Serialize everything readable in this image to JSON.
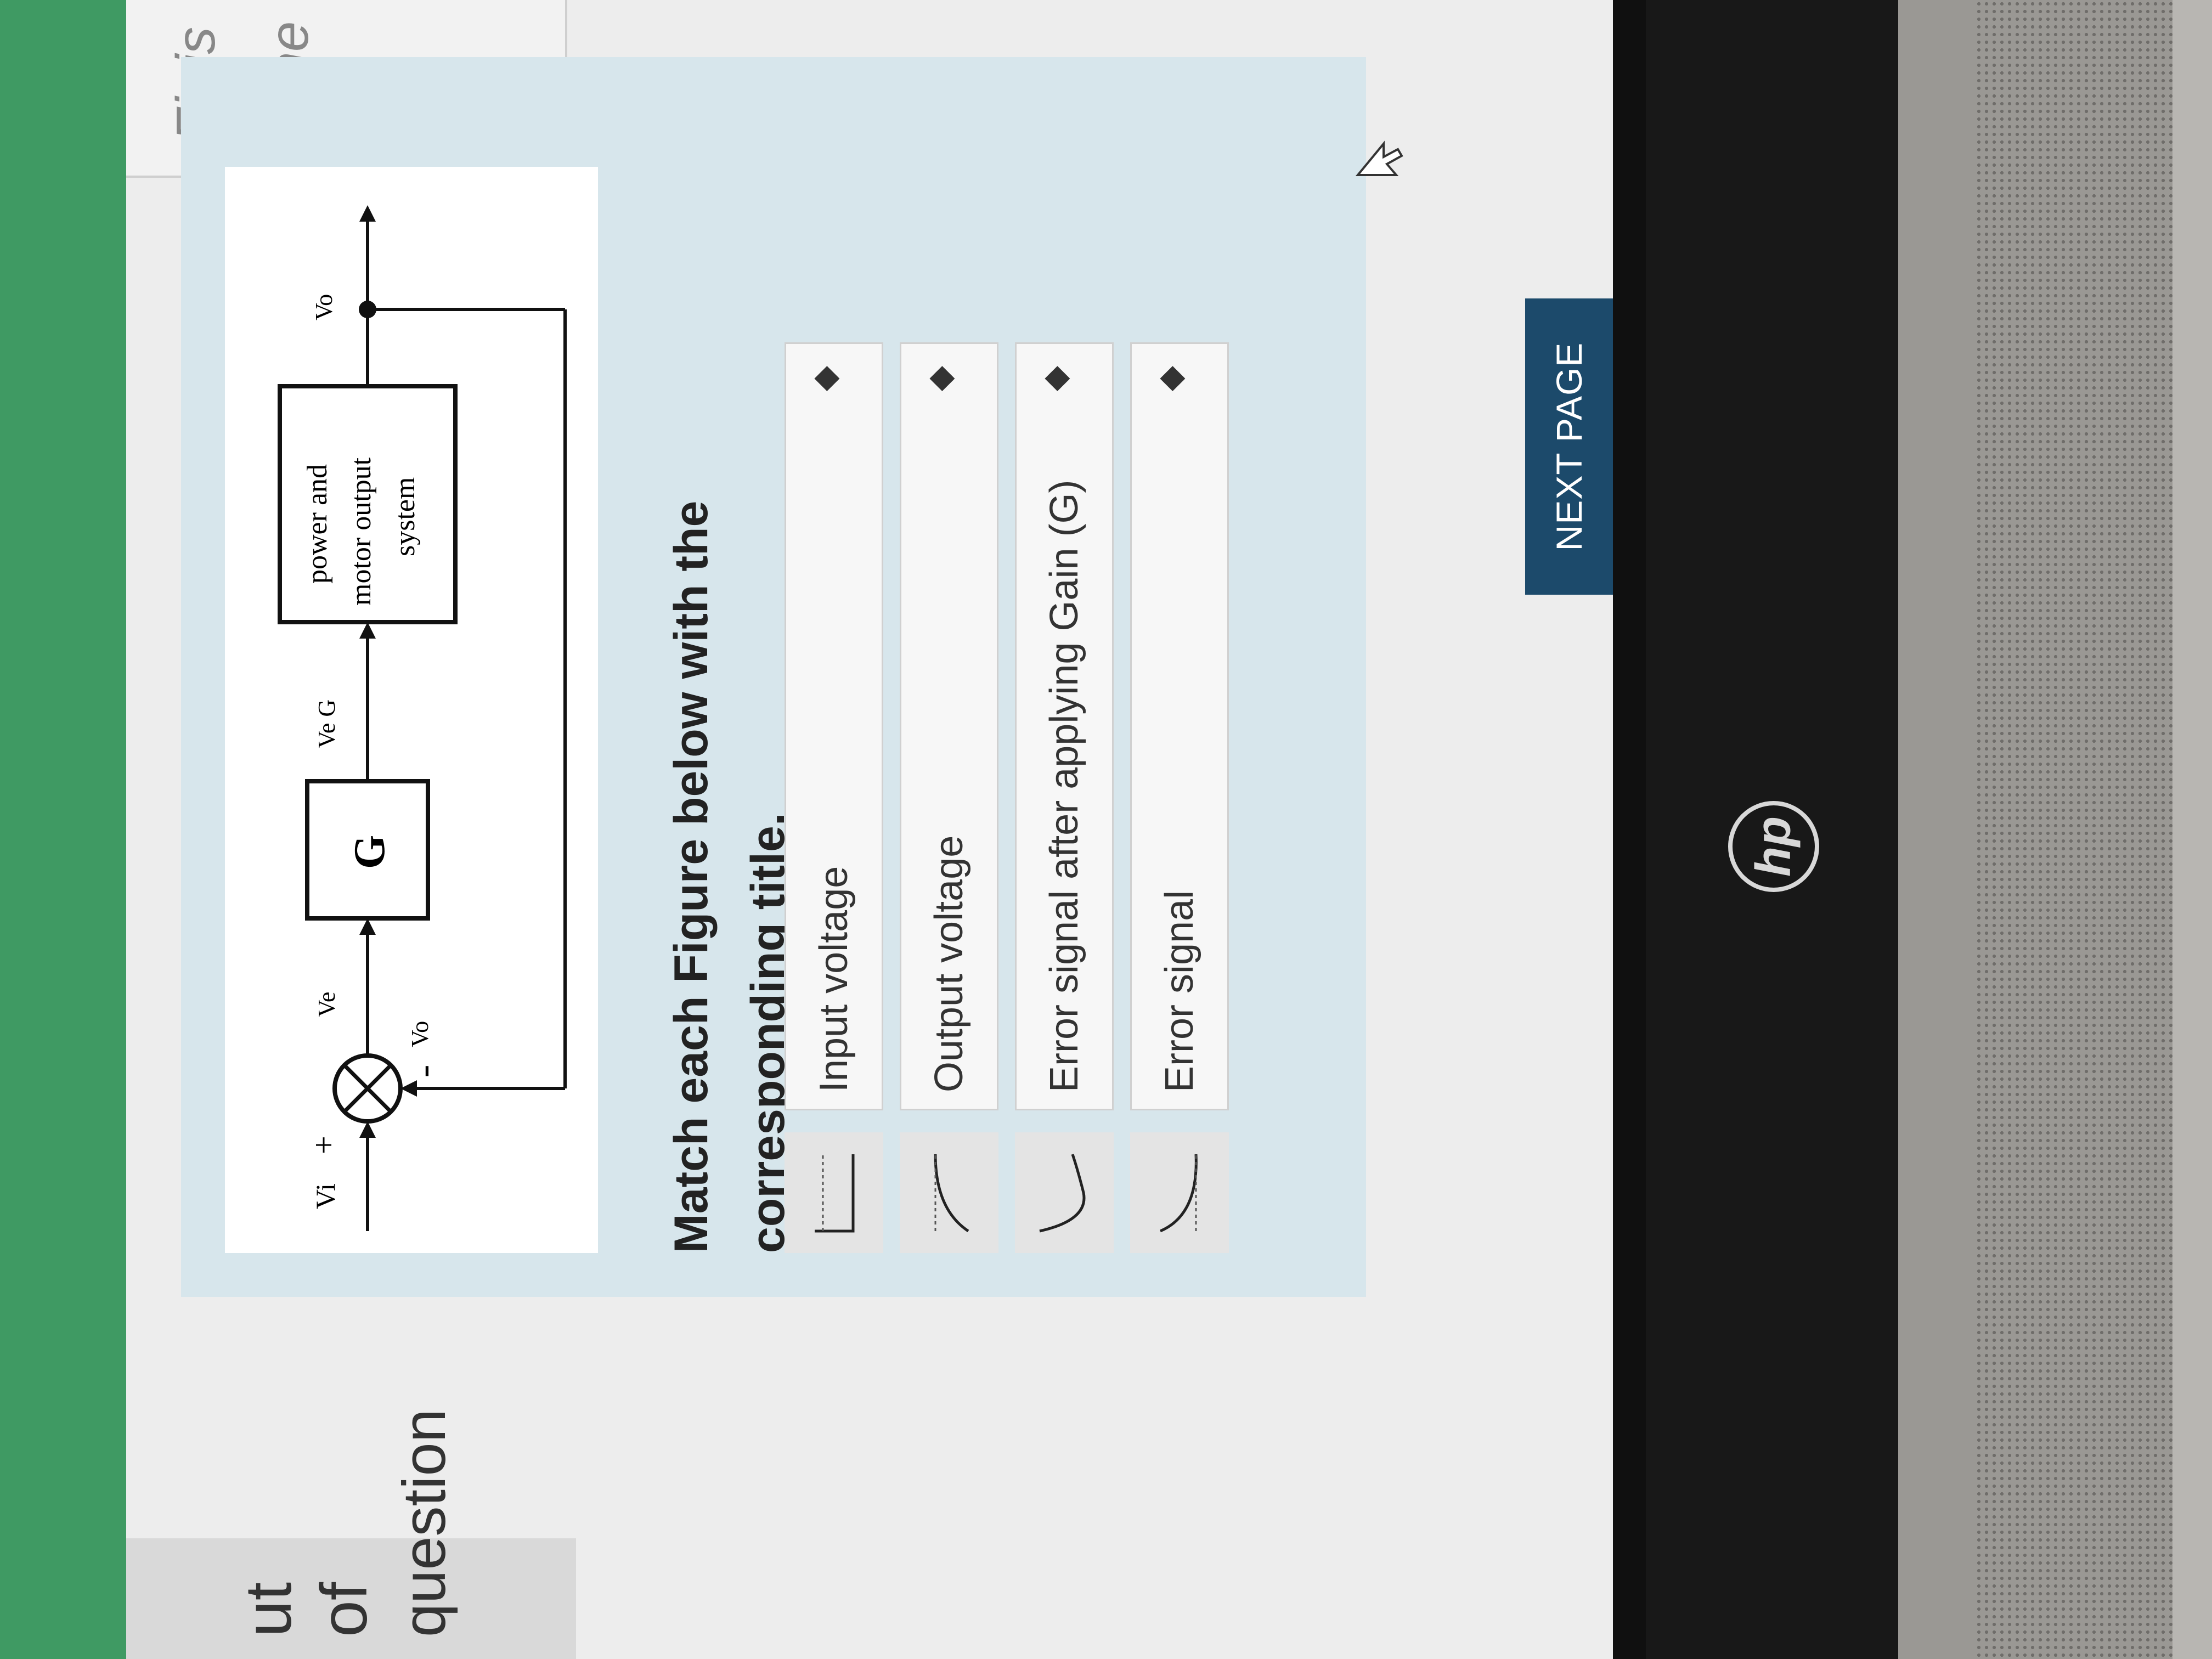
{
  "nav": {
    "out_of": "ut of",
    "question": "question"
  },
  "info": {
    "finish": "Finis",
    "time": "Time"
  },
  "figure": {
    "vi_label": "Vi",
    "plus": "+",
    "minus": "-",
    "ve_label": "Ve",
    "vo_feedback": "Vo",
    "g_label": "G",
    "veg_label": "Ve G",
    "block_line1": "power and",
    "block_line2": "motor output",
    "block_line3": "system",
    "vo_label": "Vo"
  },
  "question": {
    "text": "Match each Figure below with the corresponding title."
  },
  "options": [
    {
      "label": "Input voltage"
    },
    {
      "label": "Output voltage"
    },
    {
      "label": "Error signal after applying Gain (G)"
    },
    {
      "label": "Error signal"
    }
  ],
  "select_arrow": "◆",
  "next_button": "NEXT PAGE",
  "taskbar_icons": [
    "mail-icon",
    "amazon-icon",
    "power-icon",
    "store-icon",
    "chrome-icon",
    "snip-icon",
    "teams-icon",
    "onenote-icon",
    "dropbox-icon",
    "help-icon",
    "chevron-icon",
    "usb-icon",
    "network-icon",
    "bluetooth-icon",
    "battery-icon"
  ],
  "brand": "hp",
  "colors": {
    "green_strip": "#3f9a63",
    "card_bg": "#d7e6ec",
    "next_button_bg": "#1c4a6b"
  }
}
